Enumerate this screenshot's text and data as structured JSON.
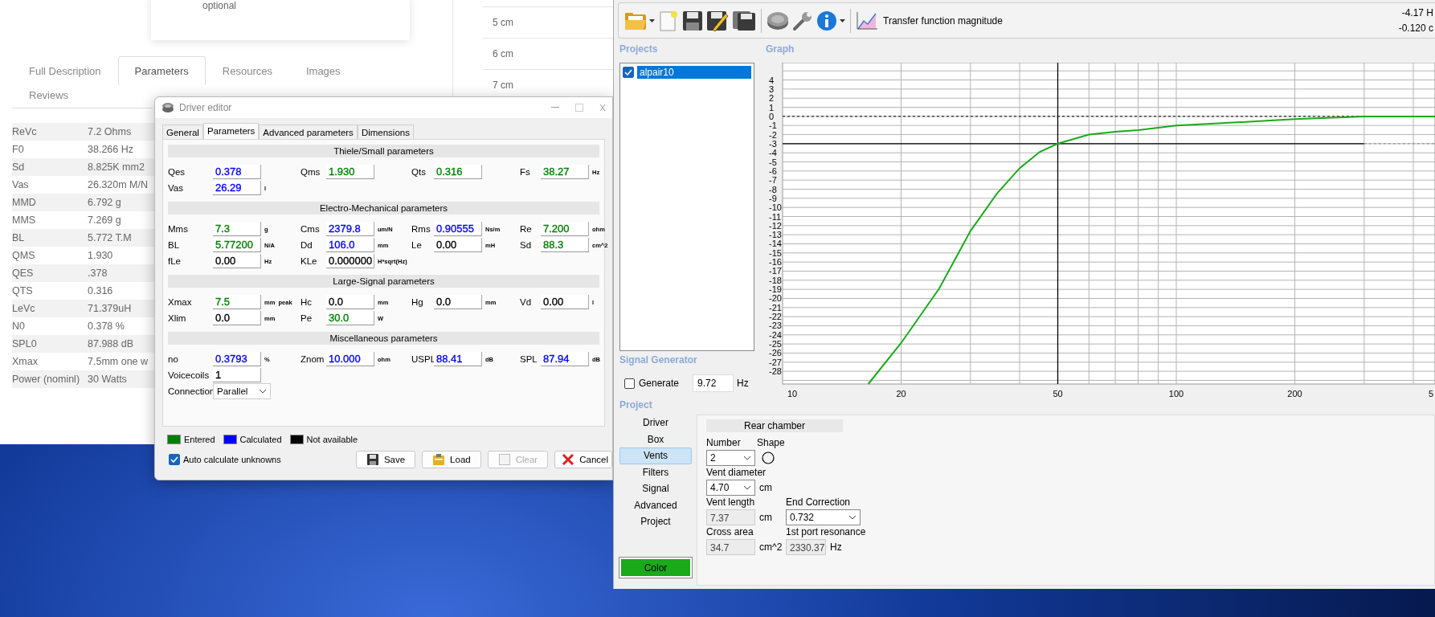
{
  "web_page": {
    "card_note": "optional",
    "side_rows": [
      "5 cm",
      "6 cm",
      "7 cm"
    ],
    "tabs": [
      {
        "label": "Full Description",
        "selected": false
      },
      {
        "label": "Parameters",
        "selected": true
      },
      {
        "label": "Resources",
        "selected": false
      },
      {
        "label": "Images",
        "selected": false
      },
      {
        "label": "Reviews",
        "selected": false
      }
    ],
    "spec_rows": [
      {
        "name": "ReVc",
        "value": "7.2 Ohms"
      },
      {
        "name": "F0",
        "value": "38.266 Hz"
      },
      {
        "name": "Sd",
        "value": "8.825K mm2"
      },
      {
        "name": "Vas",
        "value": "26.320m M/N"
      },
      {
        "name": "MMD",
        "value": "6.792 g"
      },
      {
        "name": "MMS",
        "value": "7.269 g"
      },
      {
        "name": "BL",
        "value": "5.772 T.M"
      },
      {
        "name": "QMS",
        "value": "1.930"
      },
      {
        "name": "QES",
        "value": ".378"
      },
      {
        "name": "QTS",
        "value": "0.316"
      },
      {
        "name": "LeVc",
        "value": "71.379uH"
      },
      {
        "name": "N0",
        "value": "0.378 %"
      },
      {
        "name": "SPL0",
        "value": "87.988 dB"
      },
      {
        "name": "Xmax",
        "value": "7.5mm one w"
      },
      {
        "name": "Power (nominl)",
        "value": "30 Watts"
      }
    ]
  },
  "driver_editor": {
    "title": "Driver editor",
    "tabs": [
      {
        "label": "General",
        "selected": false
      },
      {
        "label": "Parameters",
        "selected": true
      },
      {
        "label": "Advanced parameters",
        "selected": false
      },
      {
        "label": "Dimensions",
        "selected": false
      }
    ],
    "sections": [
      {
        "title": "Thiele/Small parameters",
        "rows": [
          [
            {
              "kind": "field",
              "label": "Qes",
              "value": "0.378",
              "color": "#0000ff"
            },
            {
              "kind": "field",
              "label": "Qms",
              "value": "1.930",
              "color": "#008000"
            },
            {
              "kind": "field",
              "label": "Qts",
              "value": "0.316",
              "color": "#008000"
            },
            {
              "kind": "field",
              "label": "Fs",
              "value": "38.27",
              "color": "#008000",
              "unit": "Hz"
            }
          ],
          [
            {
              "kind": "field",
              "label": "Vas",
              "value": "26.29",
              "color": "#0000ff",
              "unit": "l"
            }
          ]
        ]
      },
      {
        "title": "Electro-Mechanical parameters",
        "rows": [
          [
            {
              "kind": "field",
              "label": "Mms",
              "value": "7.3",
              "color": "#008000",
              "unit": "g"
            },
            {
              "kind": "field",
              "label": "Cms",
              "value": "2379.8",
              "color": "#0000ff",
              "unit": "um/N"
            },
            {
              "kind": "field",
              "label": "Rms",
              "value": "0.90555",
              "color": "#0000ff",
              "unit": "Ns/m"
            },
            {
              "kind": "field",
              "label": "Re",
              "value": "7.200",
              "color": "#008000",
              "unit": "ohm"
            }
          ],
          [
            {
              "kind": "field",
              "label": "BL",
              "value": "5.77200",
              "color": "#008000",
              "unit": "N/A"
            },
            {
              "kind": "field",
              "label": "Dd",
              "value": "106.0",
              "color": "#0000ff",
              "unit": "mm"
            },
            {
              "kind": "field",
              "label": "Le",
              "value": "0.00",
              "color": "#000000",
              "unit": "mH"
            },
            {
              "kind": "field",
              "label": "Sd",
              "value": "88.3",
              "color": "#008000",
              "unit": "cm^2"
            }
          ],
          [
            {
              "kind": "field",
              "label": "fLe",
              "value": "0.00",
              "color": "#000000",
              "unit": "Hz"
            },
            {
              "kind": "field",
              "label": "KLe",
              "value": "0.000000",
              "color": "#000000",
              "unit": "H*sqrt(Hz)"
            }
          ]
        ]
      },
      {
        "title": "Large-Signal parameters",
        "rows": [
          [
            {
              "kind": "field",
              "label": "Xmax",
              "value": "7.5",
              "color": "#008000",
              "unit": "mm  peak"
            },
            {
              "kind": "field",
              "label": "Hc",
              "value": "0.0",
              "color": "#000000",
              "unit": "mm"
            },
            {
              "kind": "field",
              "label": "Hg",
              "value": "0.0",
              "color": "#000000",
              "unit": "mm"
            },
            {
              "kind": "field",
              "label": "Vd",
              "value": "0.00",
              "color": "#000000",
              "unit": "l"
            }
          ],
          [
            {
              "kind": "field",
              "label": "Xlim",
              "value": "0.0",
              "color": "#000000",
              "unit": "mm"
            },
            {
              "kind": "field",
              "label": "Pe",
              "value": "30.0",
              "color": "#008000",
              "unit": "W"
            }
          ]
        ]
      },
      {
        "title": "Miscellaneous parameters",
        "rows": [
          [
            {
              "kind": "field",
              "label": "no",
              "value": "0.3793",
              "color": "#0000ff",
              "unit": "%"
            },
            {
              "kind": "field",
              "label": "Znom",
              "value": "10.000",
              "color": "#0000ff",
              "unit": "ohm"
            },
            {
              "kind": "field",
              "label": "USPL",
              "value": "88.41",
              "color": "#0000ff",
              "unit": "dB"
            },
            {
              "kind": "field",
              "label": "SPL",
              "value": "87.94",
              "color": "#0000ff",
              "unit": "dB"
            }
          ],
          [
            {
              "kind": "field",
              "label": "Voicecoils",
              "value": "1",
              "color": "#000000"
            }
          ],
          [
            {
              "kind": "dropdown",
              "label": "Connection",
              "value": "Parallel"
            }
          ]
        ]
      }
    ],
    "legend": [
      {
        "label": "Entered",
        "color": "#008000"
      },
      {
        "label": "Calculated",
        "color": "#0000ff"
      },
      {
        "label": "Not available",
        "color": "#000000"
      }
    ],
    "auto_calculate": {
      "label": "Auto calculate unknowns",
      "checked": true
    },
    "buttons": [
      {
        "kind": "save",
        "label": "Save",
        "disabled": false
      },
      {
        "kind": "load",
        "label": "Load",
        "disabled": false
      },
      {
        "kind": "clear",
        "label": "Clear",
        "disabled": true
      },
      {
        "kind": "cancel",
        "label": "Cancel",
        "disabled": false
      }
    ]
  },
  "app": {
    "toolbar": {
      "tools": [
        {
          "kind": "open",
          "menu": true
        },
        {
          "kind": "new",
          "menu": false
        },
        {
          "kind": "save",
          "menu": false
        },
        {
          "kind": "save_as",
          "menu": false
        },
        {
          "kind": "save_all",
          "menu": false
        },
        {
          "kind": "driver",
          "menu": false
        },
        {
          "kind": "tools",
          "menu": false
        },
        {
          "kind": "info",
          "menu": true
        }
      ],
      "view_label": "Transfer function magnitude",
      "readouts": [
        "-4.17 H",
        "-0.120 c"
      ]
    },
    "projects": {
      "title": "Projects",
      "items": [
        {
          "name": "alpair10",
          "checked": true,
          "selected": true
        }
      ]
    },
    "graph": {
      "title": "Graph",
      "y_labels": [
        "4",
        "3",
        "2",
        "1",
        "0",
        "-1",
        "-2",
        "-3",
        "-4",
        "-5",
        "-6",
        "-7",
        "-8",
        "-9",
        "-10",
        "-11",
        "-12",
        "-13",
        "-14",
        "-15",
        "-16",
        "-17",
        "-18",
        "-19",
        "-20",
        "-21",
        "-22",
        "-23",
        "-24",
        "-25",
        "-26",
        "-27",
        "-28"
      ],
      "x_labels": [
        "10",
        "20",
        "50",
        "100",
        "200",
        "5"
      ]
    },
    "signal_generator": {
      "title": "Signal Generator",
      "generate": {
        "label": "Generate",
        "checked": false
      },
      "frequency": "9.72",
      "unit": "Hz"
    },
    "project": {
      "title": "Project",
      "nav": [
        {
          "label": "Driver",
          "selected": false
        },
        {
          "label": "Box",
          "selected": false
        },
        {
          "label": "Vents",
          "selected": true
        },
        {
          "label": "Filters",
          "selected": false
        },
        {
          "label": "Signal",
          "selected": false
        },
        {
          "label": "Advanced",
          "selected": false
        },
        {
          "label": "Project",
          "selected": false
        }
      ],
      "color_button": "Color",
      "vents": {
        "header": "Rear chamber",
        "number": {
          "label": "Number",
          "value": "2"
        },
        "shape": {
          "label": "Shape"
        },
        "vent_diameter": {
          "label": "Vent diameter",
          "value": "4.70",
          "unit": "cm"
        },
        "vent_length": {
          "label": "Vent length",
          "value": "7.37",
          "unit": "cm",
          "disabled": true
        },
        "end_correction": {
          "label": "End Correction",
          "value": "0.732"
        },
        "cross_area": {
          "label": "Cross area",
          "value": "34.7",
          "unit": "cm^2",
          "disabled": true
        },
        "port_resonance": {
          "label": "1st port resonance",
          "value": "2330.37",
          "unit": "Hz",
          "disabled": true
        }
      }
    }
  }
}
